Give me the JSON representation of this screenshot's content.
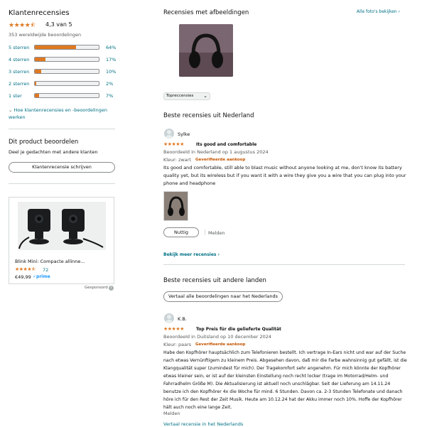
{
  "left": {
    "title": "Klantenrecensies",
    "rating_stars": "★★★★⯪",
    "rating_text": "4,3 van 5",
    "global_ratings": "353 wereldwijde beoordelingen",
    "histogram": [
      {
        "label": "5 sterren",
        "percent": 64,
        "percent_text": "64%"
      },
      {
        "label": "4 sterren",
        "percent": 17,
        "percent_text": "17%"
      },
      {
        "label": "3 sterren",
        "percent": 10,
        "percent_text": "10%"
      },
      {
        "label": "2 sterren",
        "percent": 2,
        "percent_text": "2%"
      },
      {
        "label": "1 ster",
        "percent": 7,
        "percent_text": "7%"
      }
    ],
    "how_calculated": "Hoe klantenrecensies en -beoordelingen werken",
    "rate_title": "Dit product beoordelen",
    "rate_sub": "Deel je gedachten met andere klanten",
    "write_review_button": "Klantenrecensie schrijven",
    "ad": {
      "product_title": "Blink Mini: Compacte allinne...",
      "stars": "★★★★⯪",
      "rating_count": "72",
      "price": "€49,99",
      "prime": "✓prime",
      "sponsored": "Gesponsord",
      "info_icon": "info-icon"
    }
  },
  "right": {
    "images_title": "Recensies met afbeeldingen",
    "all_photos_link": "Alle foto's bekijken ›",
    "sort_select": "Topreccensies",
    "top_nl_title": "Beste recensies uit Nederland",
    "review1": {
      "author": "Sylke",
      "stars": "★★★★★",
      "title": "Its good and comfortable",
      "meta": "Beoordeeld in Nederland op 1 augustus 2024",
      "color": "Kleur: zwart",
      "verified": "Geverifieerde aankoop",
      "body": "Its good and comfortable, still able to blast music without anyone looking at me, don't know its battery quality yet, but its wireless but if you want it with a wire they give you a wire that you can plug into your phone and headphone",
      "helpful_button": "Nuttig",
      "report_link": "Melden"
    },
    "more_reviews_link": "Bekijk meer recensies ›",
    "top_other_title": "Beste recensies uit andere landen",
    "translate_button": "Vertaal alle beoordelingen naar het Nederlands",
    "review2": {
      "author": "K.B.",
      "stars": "★★★★★",
      "title": "Top Preis für die gelieferte Qualität",
      "meta": "Beoordeeld in Duitsland op 10 december 2024",
      "color": "Kleur: paars",
      "verified": "Geverifieerde aankoop",
      "body": "Habe den Kopfhörer hauptsächlich zum Telefonieren bestellt. Ich vertrage In-Ears nicht und war auf der Suche nach etwas Vernünftigem zu kleinem Preis. Abgesehen davon, daß mir die Farbe wahnsinnig gut gefällt, ist die Klangqualität super (zumindest für mich). Der Tragekomfort sehr angenehm. Für mich könnte der Kopfhörer etwas kleiner sein, er ist auf der kleinsten Einstellung noch recht locker (trage im Motorrad/Helm- und Fahrradhelm Größe M). Die Aktualisierung ist aktuell noch unschlägbar. Seit der Lieferung am 14.11.24 benutze ich den Kopfhörer 4x die Woche für mind. 6 Stunden. Davon ca. 2-3 Stunden Telefonate und danach höre ich für den Rest der Zeit Musik. Heute am 10.12.24 hat der Akku immer noch 10%. Hoffe der Kopfhörer hält auch noch eine lange Zeit.",
      "report_link": "Melden",
      "translate_link": "Vertaal recensie in het Nederlands"
    }
  },
  "colors": {
    "accent_star": "#de7921",
    "link": "#007185",
    "verified": "#c45500"
  }
}
